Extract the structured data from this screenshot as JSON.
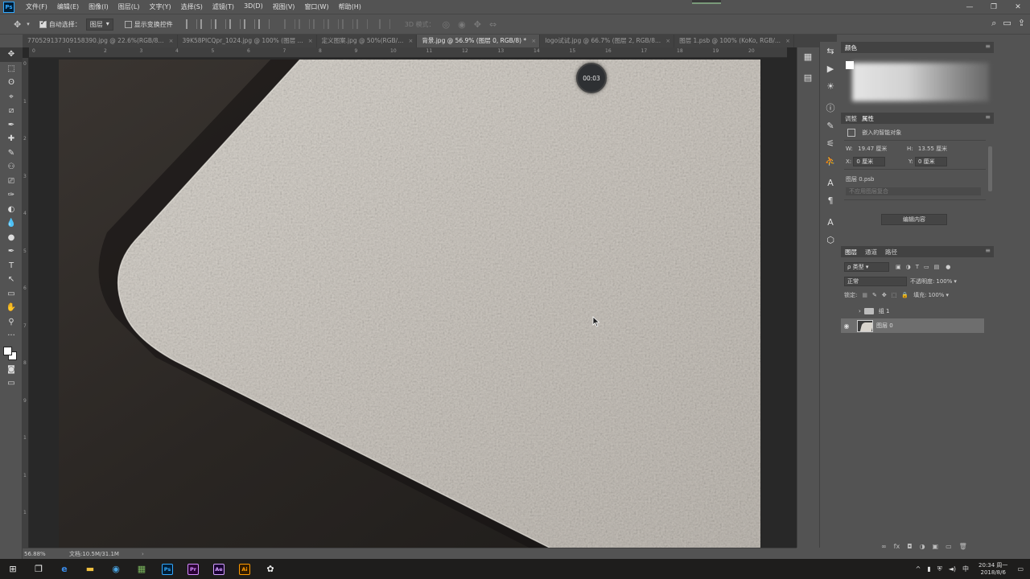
{
  "menu": {
    "items": [
      "文件(F)",
      "编辑(E)",
      "图像(I)",
      "图层(L)",
      "文字(Y)",
      "选择(S)",
      "滤镜(T)",
      "3D(D)",
      "视图(V)",
      "窗口(W)",
      "帮助(H)"
    ],
    "logo": "Ps"
  },
  "window": {
    "minimize": "—",
    "maximize": "❐",
    "close": "✕"
  },
  "options": {
    "move_icon": "✥",
    "auto_select_label": "自动选择：",
    "auto_select_value": "图层",
    "show_transform_label": "显示变换控件",
    "mode_3d_label": "3D 模式：",
    "right_icons": [
      "⌕",
      "▭",
      "⇪"
    ]
  },
  "tabs": [
    {
      "label": "770529137309158390.jpg @ 22.6%(RGB/8...",
      "active": false
    },
    {
      "label": "39K58PICQpr_1024.jpg @ 100% (图层 ...",
      "active": false
    },
    {
      "label": "定义图案.jpg @ 50%(RGB/...",
      "active": false
    },
    {
      "label": "背景.jpg @ 56.9% (图层 0, RGB/8) *",
      "active": true
    },
    {
      "label": "logo试试.jpg @ 66.7% (图层 2, RGB/8...",
      "active": false
    },
    {
      "label": "图层 1.psb @ 100% (KoKo, RGB/...",
      "active": false
    }
  ],
  "tools": [
    "✥",
    "⬚",
    "ʘ",
    "⌖",
    "⧄",
    "✒",
    "✚",
    "✎",
    "⚇",
    "⎚",
    "✑",
    "◐",
    "💧",
    "●",
    "✒",
    "T",
    "↖",
    "▭",
    "✋",
    "⚲",
    "···"
  ],
  "ruler": {
    "top": [
      "0",
      "1",
      "2",
      "3",
      "4",
      "5",
      "6",
      "7",
      "8",
      "9",
      "10",
      "11",
      "12",
      "13",
      "14",
      "15",
      "16",
      "17",
      "18",
      "19",
      "20"
    ],
    "left": [
      "0",
      "1",
      "2",
      "3",
      "4",
      "5",
      "6",
      "7",
      "8",
      "9",
      "1",
      "1",
      "1"
    ]
  },
  "canvas": {
    "timer": "00:03"
  },
  "status": {
    "zoom": "56.88%",
    "doc_size": "文档:10.5M/31.1M",
    "arrow": "›"
  },
  "strip1_icons": [
    "▦",
    "▤"
  ],
  "strip2_icons": [
    "⇆",
    "▶",
    "☀",
    "ⓘ",
    "✎",
    "⚟",
    "⛹",
    "A",
    "¶",
    "A",
    "⬡"
  ],
  "panels": {
    "color": {
      "title": "颜色"
    },
    "properties": {
      "tabs": [
        "调整",
        "属性"
      ],
      "object_type": "嵌入的智能对象",
      "w_label": "W:",
      "w_value": "19.47 厘米",
      "h_label": "H:",
      "h_value": "13.55 厘米",
      "x_label": "X:",
      "x_value": "0 厘米",
      "y_label": "Y:",
      "y_value": "0 厘米",
      "file_name": "图层 0.psb",
      "comp_placeholder": "不应用图层复合",
      "edit_contents": "编辑内容"
    },
    "layers": {
      "tabs": [
        "图层",
        "通道",
        "路径"
      ],
      "filter_label": "ρ 类型",
      "blend_mode": "正常",
      "opacity_label": "不透明度:",
      "opacity_value": "100%",
      "lock_label": "锁定:",
      "fill_label": "填充:",
      "fill_value": "100%",
      "rows": [
        {
          "name": "组 1",
          "type": "group",
          "visible": false,
          "selected": false
        },
        {
          "name": "图层 0",
          "type": "layer",
          "visible": true,
          "selected": true
        }
      ],
      "footer_icons": [
        "∞",
        "fx",
        "◘",
        "◑",
        "▣",
        "▭",
        "🗑"
      ]
    }
  },
  "taskbar": {
    "apps": [
      {
        "label": "Ps",
        "bg": "#001e36",
        "fg": "#31a8ff"
      },
      {
        "label": "Pr",
        "bg": "#2a0034",
        "fg": "#d48cff"
      },
      {
        "label": "Ae",
        "bg": "#1a0033",
        "fg": "#d4a0ff"
      },
      {
        "label": "Ai",
        "bg": "#331c00",
        "fg": "#ff9a00"
      }
    ],
    "tray_lang": "中",
    "time": "20:34 周一",
    "date": "2018/8/6"
  }
}
